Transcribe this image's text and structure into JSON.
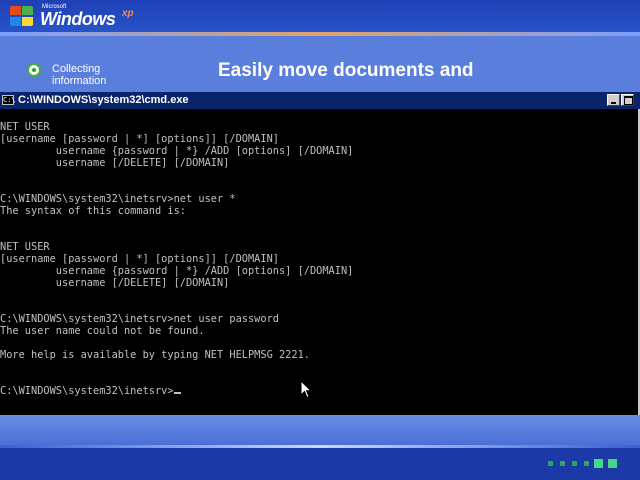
{
  "setup": {
    "logo": {
      "company": "Microsoft",
      "product": "Windows",
      "version": "xp"
    },
    "step_label": "Collecting information",
    "headline": "Easily move documents and",
    "progress_dots": [
      false,
      false,
      false,
      false,
      true,
      true
    ]
  },
  "cmd_window": {
    "title": "C:\\WINDOWS\\system32\\cmd.exe",
    "icon_text": "C:\\",
    "lines": [
      "",
      "NET USER",
      "[username [password | *] [options]] [/DOMAIN]",
      "         username {password | *} /ADD [options] [/DOMAIN]",
      "         username [/DELETE] [/DOMAIN]",
      "",
      "",
      "C:\\WINDOWS\\system32\\inetsrv>net user *",
      "The syntax of this command is:",
      "",
      "",
      "NET USER",
      "[username [password | *] [options]] [/DOMAIN]",
      "         username {password | *} /ADD [options] [/DOMAIN]",
      "         username [/DELETE] [/DOMAIN]",
      "",
      "",
      "C:\\WINDOWS\\system32\\inetsrv>net user password",
      "The user name could not be found.",
      "",
      "More help is available by typing NET HELPMSG 2221.",
      "",
      "",
      "C:\\WINDOWS\\system32\\inetsrv>"
    ]
  },
  "colors": {
    "cmd_background": "#000000",
    "cmd_text": "#c0c0c0",
    "titlebar": "#0a246a",
    "setup_background": "#5a7edc"
  }
}
